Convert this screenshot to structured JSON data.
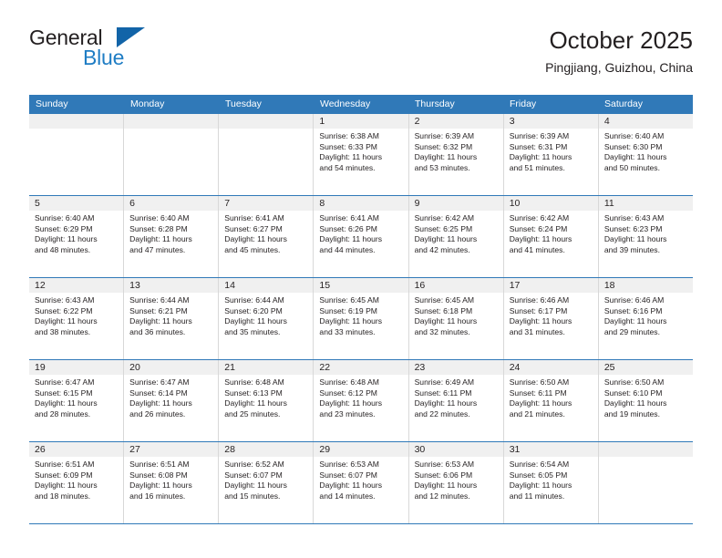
{
  "brand": {
    "word1": "General",
    "word2": "Blue",
    "accent_color": "#1f7dc4",
    "triangle_color": "#1264a8"
  },
  "header": {
    "title": "October 2025",
    "location": "Pingjiang, Guizhou, China"
  },
  "theme": {
    "header_bar_color": "#3079b8",
    "daynum_band_color": "#f0f0f0",
    "row_divider_color": "#3079b8",
    "cell_divider_color": "#d8d8d8",
    "text_color": "#231f20"
  },
  "weekdays": [
    "Sunday",
    "Monday",
    "Tuesday",
    "Wednesday",
    "Thursday",
    "Friday",
    "Saturday"
  ],
  "weeks": [
    [
      {
        "day": "",
        "sunrise": "",
        "sunset": "",
        "daylight1": "",
        "daylight2": ""
      },
      {
        "day": "",
        "sunrise": "",
        "sunset": "",
        "daylight1": "",
        "daylight2": ""
      },
      {
        "day": "",
        "sunrise": "",
        "sunset": "",
        "daylight1": "",
        "daylight2": ""
      },
      {
        "day": "1",
        "sunrise": "Sunrise: 6:38 AM",
        "sunset": "Sunset: 6:33 PM",
        "daylight1": "Daylight: 11 hours",
        "daylight2": "and 54 minutes."
      },
      {
        "day": "2",
        "sunrise": "Sunrise: 6:39 AM",
        "sunset": "Sunset: 6:32 PM",
        "daylight1": "Daylight: 11 hours",
        "daylight2": "and 53 minutes."
      },
      {
        "day": "3",
        "sunrise": "Sunrise: 6:39 AM",
        "sunset": "Sunset: 6:31 PM",
        "daylight1": "Daylight: 11 hours",
        "daylight2": "and 51 minutes."
      },
      {
        "day": "4",
        "sunrise": "Sunrise: 6:40 AM",
        "sunset": "Sunset: 6:30 PM",
        "daylight1": "Daylight: 11 hours",
        "daylight2": "and 50 minutes."
      }
    ],
    [
      {
        "day": "5",
        "sunrise": "Sunrise: 6:40 AM",
        "sunset": "Sunset: 6:29 PM",
        "daylight1": "Daylight: 11 hours",
        "daylight2": "and 48 minutes."
      },
      {
        "day": "6",
        "sunrise": "Sunrise: 6:40 AM",
        "sunset": "Sunset: 6:28 PM",
        "daylight1": "Daylight: 11 hours",
        "daylight2": "and 47 minutes."
      },
      {
        "day": "7",
        "sunrise": "Sunrise: 6:41 AM",
        "sunset": "Sunset: 6:27 PM",
        "daylight1": "Daylight: 11 hours",
        "daylight2": "and 45 minutes."
      },
      {
        "day": "8",
        "sunrise": "Sunrise: 6:41 AM",
        "sunset": "Sunset: 6:26 PM",
        "daylight1": "Daylight: 11 hours",
        "daylight2": "and 44 minutes."
      },
      {
        "day": "9",
        "sunrise": "Sunrise: 6:42 AM",
        "sunset": "Sunset: 6:25 PM",
        "daylight1": "Daylight: 11 hours",
        "daylight2": "and 42 minutes."
      },
      {
        "day": "10",
        "sunrise": "Sunrise: 6:42 AM",
        "sunset": "Sunset: 6:24 PM",
        "daylight1": "Daylight: 11 hours",
        "daylight2": "and 41 minutes."
      },
      {
        "day": "11",
        "sunrise": "Sunrise: 6:43 AM",
        "sunset": "Sunset: 6:23 PM",
        "daylight1": "Daylight: 11 hours",
        "daylight2": "and 39 minutes."
      }
    ],
    [
      {
        "day": "12",
        "sunrise": "Sunrise: 6:43 AM",
        "sunset": "Sunset: 6:22 PM",
        "daylight1": "Daylight: 11 hours",
        "daylight2": "and 38 minutes."
      },
      {
        "day": "13",
        "sunrise": "Sunrise: 6:44 AM",
        "sunset": "Sunset: 6:21 PM",
        "daylight1": "Daylight: 11 hours",
        "daylight2": "and 36 minutes."
      },
      {
        "day": "14",
        "sunrise": "Sunrise: 6:44 AM",
        "sunset": "Sunset: 6:20 PM",
        "daylight1": "Daylight: 11 hours",
        "daylight2": "and 35 minutes."
      },
      {
        "day": "15",
        "sunrise": "Sunrise: 6:45 AM",
        "sunset": "Sunset: 6:19 PM",
        "daylight1": "Daylight: 11 hours",
        "daylight2": "and 33 minutes."
      },
      {
        "day": "16",
        "sunrise": "Sunrise: 6:45 AM",
        "sunset": "Sunset: 6:18 PM",
        "daylight1": "Daylight: 11 hours",
        "daylight2": "and 32 minutes."
      },
      {
        "day": "17",
        "sunrise": "Sunrise: 6:46 AM",
        "sunset": "Sunset: 6:17 PM",
        "daylight1": "Daylight: 11 hours",
        "daylight2": "and 31 minutes."
      },
      {
        "day": "18",
        "sunrise": "Sunrise: 6:46 AM",
        "sunset": "Sunset: 6:16 PM",
        "daylight1": "Daylight: 11 hours",
        "daylight2": "and 29 minutes."
      }
    ],
    [
      {
        "day": "19",
        "sunrise": "Sunrise: 6:47 AM",
        "sunset": "Sunset: 6:15 PM",
        "daylight1": "Daylight: 11 hours",
        "daylight2": "and 28 minutes."
      },
      {
        "day": "20",
        "sunrise": "Sunrise: 6:47 AM",
        "sunset": "Sunset: 6:14 PM",
        "daylight1": "Daylight: 11 hours",
        "daylight2": "and 26 minutes."
      },
      {
        "day": "21",
        "sunrise": "Sunrise: 6:48 AM",
        "sunset": "Sunset: 6:13 PM",
        "daylight1": "Daylight: 11 hours",
        "daylight2": "and 25 minutes."
      },
      {
        "day": "22",
        "sunrise": "Sunrise: 6:48 AM",
        "sunset": "Sunset: 6:12 PM",
        "daylight1": "Daylight: 11 hours",
        "daylight2": "and 23 minutes."
      },
      {
        "day": "23",
        "sunrise": "Sunrise: 6:49 AM",
        "sunset": "Sunset: 6:11 PM",
        "daylight1": "Daylight: 11 hours",
        "daylight2": "and 22 minutes."
      },
      {
        "day": "24",
        "sunrise": "Sunrise: 6:50 AM",
        "sunset": "Sunset: 6:11 PM",
        "daylight1": "Daylight: 11 hours",
        "daylight2": "and 21 minutes."
      },
      {
        "day": "25",
        "sunrise": "Sunrise: 6:50 AM",
        "sunset": "Sunset: 6:10 PM",
        "daylight1": "Daylight: 11 hours",
        "daylight2": "and 19 minutes."
      }
    ],
    [
      {
        "day": "26",
        "sunrise": "Sunrise: 6:51 AM",
        "sunset": "Sunset: 6:09 PM",
        "daylight1": "Daylight: 11 hours",
        "daylight2": "and 18 minutes."
      },
      {
        "day": "27",
        "sunrise": "Sunrise: 6:51 AM",
        "sunset": "Sunset: 6:08 PM",
        "daylight1": "Daylight: 11 hours",
        "daylight2": "and 16 minutes."
      },
      {
        "day": "28",
        "sunrise": "Sunrise: 6:52 AM",
        "sunset": "Sunset: 6:07 PM",
        "daylight1": "Daylight: 11 hours",
        "daylight2": "and 15 minutes."
      },
      {
        "day": "29",
        "sunrise": "Sunrise: 6:53 AM",
        "sunset": "Sunset: 6:07 PM",
        "daylight1": "Daylight: 11 hours",
        "daylight2": "and 14 minutes."
      },
      {
        "day": "30",
        "sunrise": "Sunrise: 6:53 AM",
        "sunset": "Sunset: 6:06 PM",
        "daylight1": "Daylight: 11 hours",
        "daylight2": "and 12 minutes."
      },
      {
        "day": "31",
        "sunrise": "Sunrise: 6:54 AM",
        "sunset": "Sunset: 6:05 PM",
        "daylight1": "Daylight: 11 hours",
        "daylight2": "and 11 minutes."
      },
      {
        "day": "",
        "sunrise": "",
        "sunset": "",
        "daylight1": "",
        "daylight2": ""
      }
    ]
  ]
}
